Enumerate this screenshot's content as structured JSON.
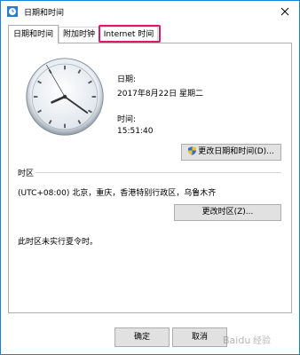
{
  "window": {
    "title": "日期和时间"
  },
  "tabs": [
    {
      "label": "日期和时间"
    },
    {
      "label": "附加时钟"
    },
    {
      "label": "Internet 时间"
    }
  ],
  "date_section": {
    "date_label": "日期:",
    "date_value": "2017年8月22日 星期二",
    "time_label": "时间:",
    "time_value": "15:51:40",
    "change_button": "更改日期和时间(D)..."
  },
  "timezone_section": {
    "heading": "时区",
    "value": "(UTC+08:00) 北京，重庆，香港特别行政区，乌鲁木齐",
    "change_button": "更改时区(Z)...",
    "dst_note": "此时区未实行夏令时。"
  },
  "footer": {
    "ok": "确定",
    "cancel": "取消"
  },
  "colors": {
    "accent": "#1883d7",
    "highlight": "#e0186c"
  },
  "watermark": "Baidu经验"
}
